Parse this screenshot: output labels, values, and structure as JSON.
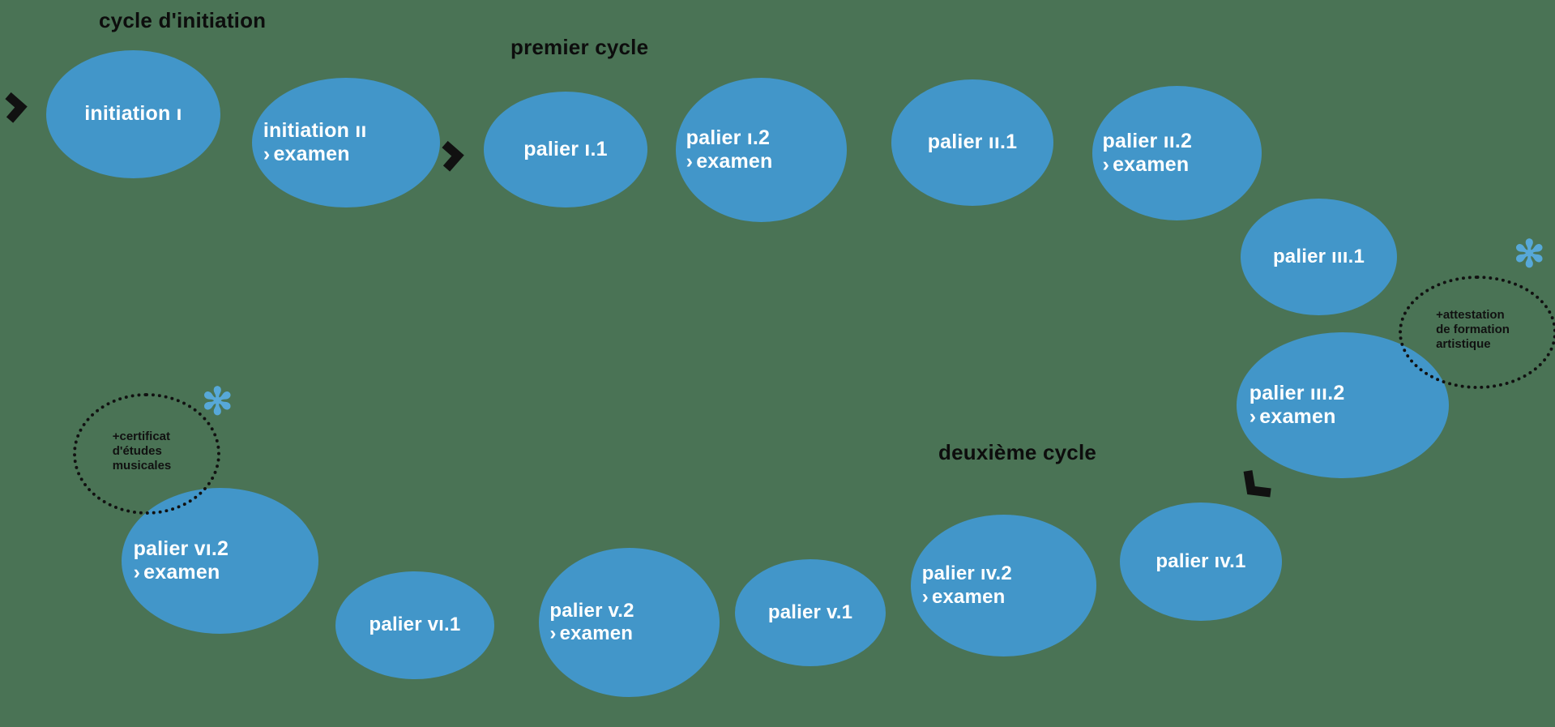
{
  "background_color": "#4a7355",
  "node_color": "#4296c9",
  "accent_color": "#57a8d8",
  "text_color": "#ffffff",
  "label_color": "#0d0d0d",
  "cycles": [
    {
      "id": "cycle-initiation",
      "label": "cycle d'initiation"
    },
    {
      "id": "premier-cycle",
      "label": "premier cycle"
    },
    {
      "id": "deuxieme-cycle",
      "label": "deuxième cycle"
    }
  ],
  "exam_chevron": "›",
  "exam_label": "examen",
  "nodes": [
    {
      "id": "initiation-1",
      "main": "initiation",
      "roman": "ı",
      "suffix": "",
      "exam": false
    },
    {
      "id": "initiation-2",
      "main": "initiation",
      "roman": "ıı",
      "suffix": "",
      "exam": true
    },
    {
      "id": "palier-i-1",
      "main": "palier",
      "roman": "ı",
      "suffix": ".1",
      "exam": false
    },
    {
      "id": "palier-i-2",
      "main": "palier",
      "roman": "ı",
      "suffix": ".2",
      "exam": true
    },
    {
      "id": "palier-ii-1",
      "main": "palier",
      "roman": "ıı",
      "suffix": ".1",
      "exam": false
    },
    {
      "id": "palier-ii-2",
      "main": "palier",
      "roman": "ıı",
      "suffix": ".2",
      "exam": true
    },
    {
      "id": "palier-iii-1",
      "main": "palier",
      "roman": "ııı",
      "suffix": ".1",
      "exam": false
    },
    {
      "id": "palier-iii-2",
      "main": "palier",
      "roman": "ııı",
      "suffix": ".2",
      "exam": true
    },
    {
      "id": "palier-iv-1",
      "main": "palier",
      "roman": "ıv",
      "suffix": ".1",
      "exam": false
    },
    {
      "id": "palier-iv-2",
      "main": "palier",
      "roman": "ıv",
      "suffix": ".2",
      "exam": true
    },
    {
      "id": "palier-v-1",
      "main": "palier",
      "roman": "v",
      "suffix": ".1",
      "exam": false
    },
    {
      "id": "palier-v-2",
      "main": "palier",
      "roman": "v",
      "suffix": ".2",
      "exam": true
    },
    {
      "id": "palier-vi-1",
      "main": "palier",
      "roman": "vı",
      "suffix": ".1",
      "exam": false
    },
    {
      "id": "palier-vi-2",
      "main": "palier",
      "roman": "vı",
      "suffix": ".2",
      "exam": true
    }
  ],
  "node_labels": {
    "initiation_1": "initiation ı",
    "initiation_2": "initiation ıı",
    "palier_i_1": "palier ı.1",
    "palier_i_2": "palier ı.2",
    "palier_ii_1": "palier ıı.1",
    "palier_ii_2": "palier ıı.2",
    "palier_iii_1": "palier ııı.1",
    "palier_iii_2": "palier ııı.2",
    "palier_iv_1": "palier ıv.1",
    "palier_iv_2": "palier ıv.2",
    "palier_v_1": "palier v.1",
    "palier_v_2": "palier v.2",
    "palier_vi_1": "palier vı.1",
    "palier_vi_2": "palier vı.2"
  },
  "annotations": [
    {
      "id": "attestation",
      "text": "+attestation\nde formation\nartistique",
      "star": "✻"
    },
    {
      "id": "certificat",
      "text": "+certificat\nd'études\nmusicales",
      "star": "✻"
    }
  ],
  "connectors": [
    {
      "id": "connector-start",
      "direction": "right"
    },
    {
      "id": "connector-initiation-to-premier",
      "direction": "right"
    },
    {
      "id": "connector-premier-to-deuxieme",
      "direction": "down-left"
    }
  ]
}
